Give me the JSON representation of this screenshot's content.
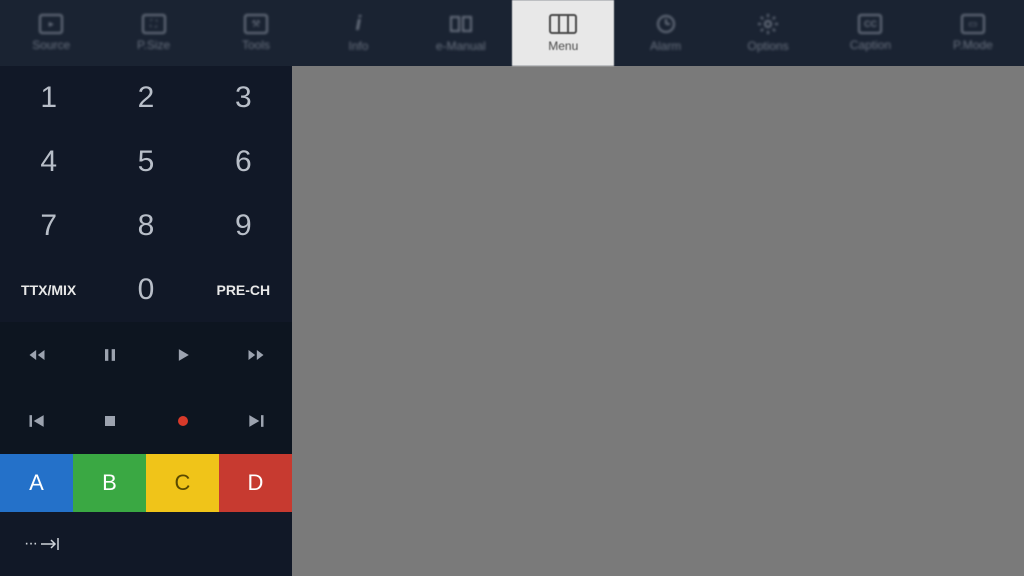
{
  "topbar": [
    {
      "label": "Source",
      "icon": "source"
    },
    {
      "label": "P.Size",
      "icon": "psize"
    },
    {
      "label": "Tools",
      "icon": "tools"
    },
    {
      "label": "Info",
      "icon": "info"
    },
    {
      "label": "e-Manual",
      "icon": "emanual"
    },
    {
      "label": "Menu",
      "icon": "menu",
      "active": true
    },
    {
      "label": "Alarm",
      "icon": "alarm"
    },
    {
      "label": "Options",
      "icon": "options"
    },
    {
      "label": "Caption",
      "icon": "caption"
    },
    {
      "label": "P.Mode",
      "icon": "pmode"
    }
  ],
  "numpad": [
    {
      "label": "1"
    },
    {
      "label": "2"
    },
    {
      "label": "3"
    },
    {
      "label": "4"
    },
    {
      "label": "5"
    },
    {
      "label": "6"
    },
    {
      "label": "7"
    },
    {
      "label": "8"
    },
    {
      "label": "9"
    },
    {
      "label": "TTX/MIX",
      "small": true
    },
    {
      "label": "0"
    },
    {
      "label": "PRE-CH",
      "small": true
    }
  ],
  "colors": {
    "a": "A",
    "b": "B",
    "c": "C",
    "d": "D"
  }
}
